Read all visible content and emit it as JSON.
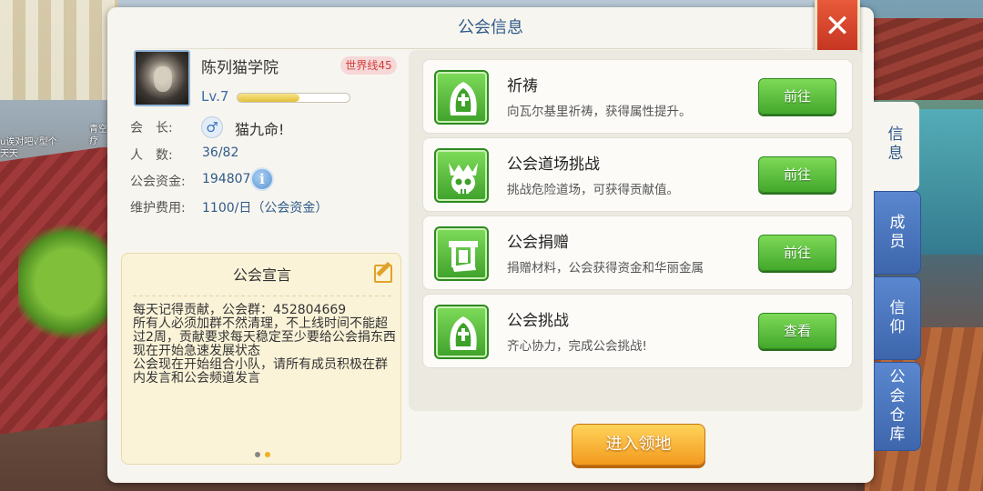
{
  "panel": {
    "title": "公会信息",
    "close_label": "✕"
  },
  "guild": {
    "name": "陈列猫学院",
    "world_badge": "世界线45",
    "level": "Lv.7",
    "xp_fraction": 0.55,
    "leader_label": "会　长:",
    "leader_gender_icon": "♂",
    "leader_name": "猫九命!",
    "members_label": "人　数:",
    "members_value": "36/82",
    "funds_label": "公会资金:",
    "funds_value": "194807",
    "funds_info_icon": "i",
    "upkeep_label": "维护费用:",
    "upkeep_value": "1100/日（公会资金）"
  },
  "declaration": {
    "title": "公会宣言",
    "text": "每天记得贡献，公会群：452804669\n所有人必须加群不然清理，不上线时间不能超过2周，贡献要求每天稳定至少要给公会捐东西\n现在开始急速发展状态\n公会现在开始组合小队，请所有成员积极在群内发言和公会频道发言",
    "page_dots": [
      {
        "active": false
      },
      {
        "active": true
      }
    ]
  },
  "activities": [
    {
      "title": "祈祷",
      "desc": "向瓦尔基里祈祷，获得属性提升。",
      "button": "前往",
      "icon": "prayer-icon"
    },
    {
      "title": "公会道场挑战",
      "desc": "挑战危险道场，可获得贡献值。",
      "button": "前往",
      "icon": "skull-crown-icon"
    },
    {
      "title": "公会捐赠",
      "desc": "捐赠材料，公会获得资金和华丽金属",
      "button": "前往",
      "icon": "donation-icon"
    },
    {
      "title": "公会挑战",
      "desc": "齐心协力，完成公会挑战!",
      "button": "查看",
      "icon": "prayer-icon"
    }
  ],
  "enter_button": "进入领地",
  "side_tabs": [
    {
      "label": "信息",
      "active": true
    },
    {
      "label": "成员",
      "active": false
    },
    {
      "label": "信仰",
      "active": false
    },
    {
      "label": "公会仓库",
      "active": false
    }
  ],
  "background": {
    "player_names": [
      "u诶对吧√型个",
      "天天",
      "青空",
      "疗"
    ]
  },
  "colors": {
    "title_blue": "#2f5a8a",
    "button_green": "#43a82c",
    "enter_orange": "#f29a1e",
    "close_red": "#c23220",
    "badge_red": "#d2403c",
    "tab_blue": "#3d66ac"
  }
}
